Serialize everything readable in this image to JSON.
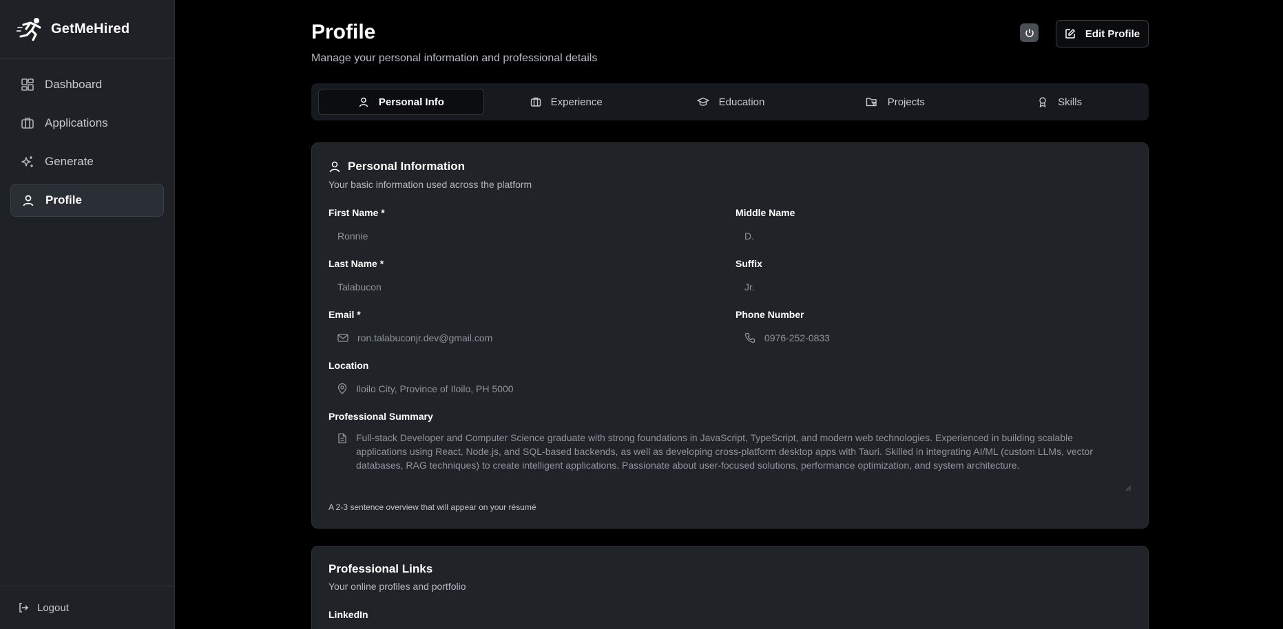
{
  "app": {
    "name": "GetMeHired"
  },
  "sidebar": {
    "items": [
      {
        "label": "Dashboard",
        "icon": "dashboard-icon"
      },
      {
        "label": "Applications",
        "icon": "briefcase-icon"
      },
      {
        "label": "Generate",
        "icon": "sparkles-icon"
      },
      {
        "label": "Profile",
        "icon": "user-icon",
        "active": true
      }
    ],
    "logout_label": "Logout"
  },
  "header": {
    "title": "Profile",
    "subtitle": "Manage your personal information and professional details",
    "edit_label": "Edit Profile"
  },
  "tabs": [
    {
      "label": "Personal Info",
      "icon": "user-icon",
      "active": true
    },
    {
      "label": "Experience",
      "icon": "briefcase-icon"
    },
    {
      "label": "Education",
      "icon": "graduation-cap-icon"
    },
    {
      "label": "Projects",
      "icon": "folder-icon"
    },
    {
      "label": "Skills",
      "icon": "award-icon"
    }
  ],
  "personal": {
    "title": "Personal Information",
    "description": "Your basic information used across the platform",
    "first_name": {
      "label": "First Name *",
      "value": "Ronnie"
    },
    "middle_name": {
      "label": "Middle Name",
      "value": "D."
    },
    "last_name": {
      "label": "Last Name *",
      "value": "Talabucon"
    },
    "suffix": {
      "label": "Suffix",
      "value": "Jr."
    },
    "email": {
      "label": "Email *",
      "value": "ron.talabuconjr.dev@gmail.com"
    },
    "phone": {
      "label": "Phone Number",
      "value": "0976-252-0833"
    },
    "location": {
      "label": "Location",
      "value": "Iloilo City, Province of Iloilo, PH 5000"
    },
    "summary": {
      "label": "Professional Summary",
      "value": "Full-stack Developer and Computer Science graduate with strong foundations in JavaScript, TypeScript, and modern web technologies. Experienced in building scalable applications using React, Node.js, and SQL-based backends, as well as developing cross-platform desktop apps with Tauri. Skilled in integrating AI/ML (custom LLMs, vector databases, RAG techniques) to create intelligent applications. Passionate about user-focused solutions, performance optimization, and system architecture.",
      "hint": "A 2-3 sentence overview that will appear on your résumé"
    }
  },
  "links": {
    "title": "Professional Links",
    "description": "Your online profiles and portfolio",
    "linkedin_label": "LinkedIn"
  },
  "colors": {
    "background": "#000000",
    "sidebar": "#1e2227",
    "card": "#202328",
    "accent_text": "#ffffff"
  }
}
